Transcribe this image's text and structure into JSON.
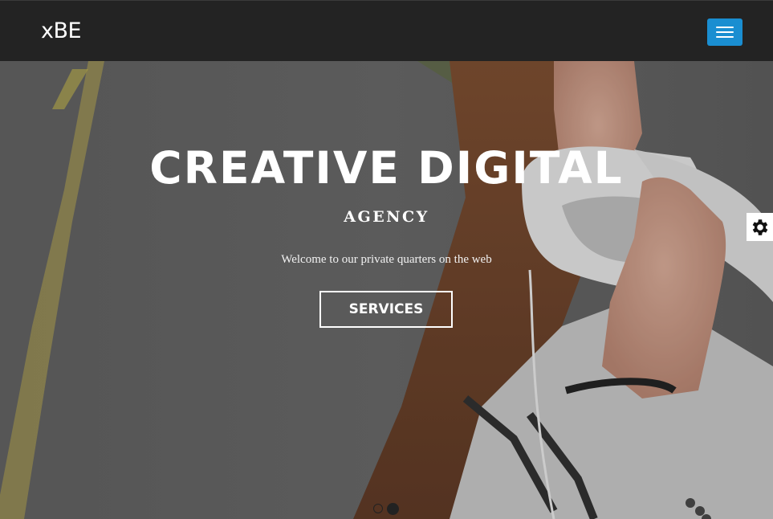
{
  "navbar": {
    "brand": "xBE",
    "menu_toggle_icon": "hamburger-icon",
    "menu_toggle_color": "#1a8ed1"
  },
  "hero": {
    "title": "CREATIVE DIGITAL",
    "subtitle": "AGENCY",
    "tagline": "Welcome to our private quarters on the web",
    "button_label": "SERVICES",
    "background_image": "photo-woman-with-headphones"
  },
  "settings_panel": {
    "icon": "gear-icon"
  },
  "carousel": {
    "slide_count": 2,
    "active_index": 1
  }
}
